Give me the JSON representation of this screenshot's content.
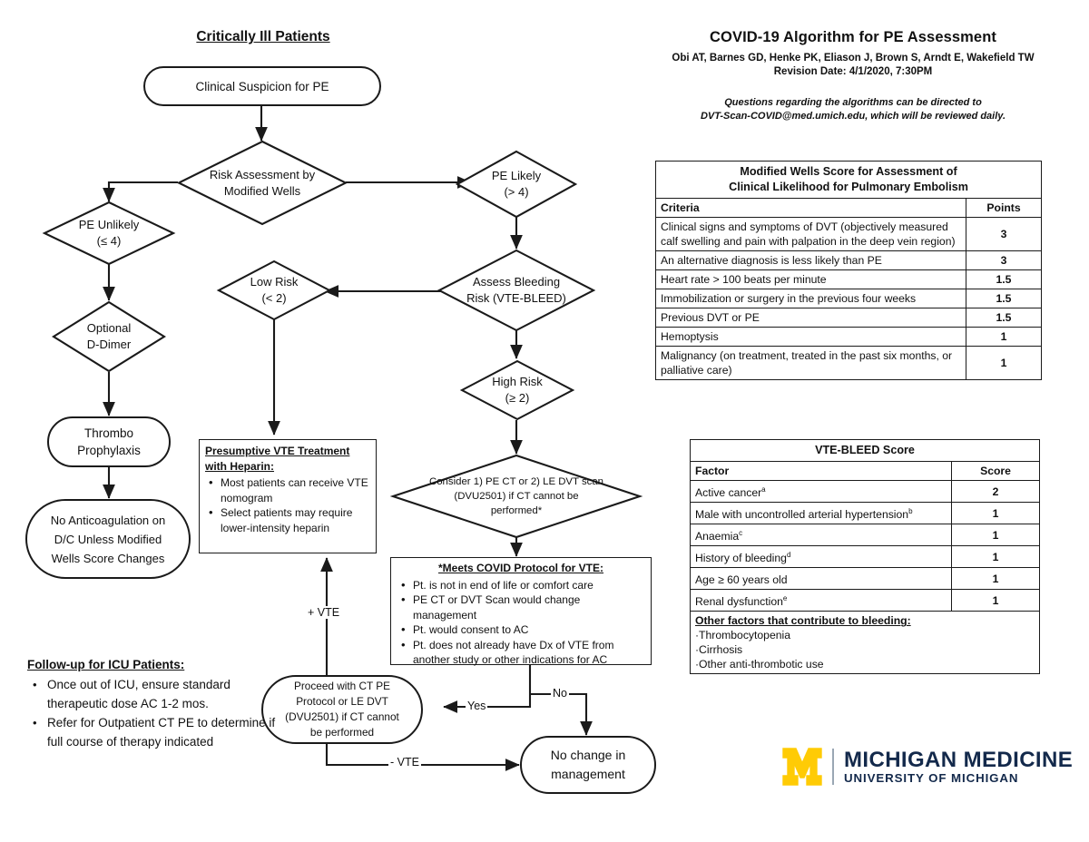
{
  "header": {
    "title": "COVID-19 Algorithm for PE Assessment",
    "authors": "Obi AT, Barnes GD, Henke PK, Eliason J, Brown S, Arndt E, Wakefield TW",
    "revision": "Revision Date: 4/1/2020, 7:30PM",
    "questions_line1": "Questions regarding the algorithms can be directed to",
    "questions_line2": "DVT-Scan-COVID@med.umich.edu, which will be reviewed daily."
  },
  "flow": {
    "section_title": "Critically Ill Patients",
    "start": "Clinical Suspicion for PE",
    "risk_assessment_l1": "Risk Assessment by",
    "risk_assessment_l2": "Modified Wells",
    "pe_unlikely_l1": "PE Unlikely",
    "pe_unlikely_l2": "(≤ 4)",
    "pe_likely_l1": "PE Likely",
    "pe_likely_l2": "(> 4)",
    "optional_ddimer_l1": "Optional",
    "optional_ddimer_l2": "D-Dimer",
    "thrombo_l1": "Thrombo",
    "thrombo_l2": "Prophylaxis",
    "no_ac_l1": "No Anticoagulation on",
    "no_ac_l2": "D/C Unless Modified",
    "no_ac_l3": "Wells Score Changes",
    "assess_bleeding_l1": "Assess Bleeding",
    "assess_bleeding_l2": "Risk (VTE-BLEED)",
    "low_risk_l1": "Low Risk",
    "low_risk_l2": "(< 2)",
    "high_risk_l1": "High Risk",
    "high_risk_l2": "(≥ 2)",
    "consider_l1": "Consider 1) PE CT or 2) LE DVT scan",
    "consider_l2": "(DVU2501) if CT cannot be",
    "consider_l3": "performed*",
    "proceed_l1": "Proceed with CT PE",
    "proceed_l2": "Protocol or LE DVT",
    "proceed_l3": "(DVU2501) if CT cannot",
    "proceed_l4": "be performed",
    "no_change_l1": "No change in",
    "no_change_l2": "management",
    "edge_yes": "Yes",
    "edge_no": "No",
    "edge_pos_vte": "+ VTE",
    "edge_neg_vte": "- VTE"
  },
  "presumptive_box": {
    "title_l1": "Presumptive VTE Treatment",
    "title_l2": "with Heparin:",
    "bullets": [
      "Most patients can receive VTE nomogram",
      "Select patients may require lower-intensity heparin"
    ]
  },
  "covid_protocol_box": {
    "title": "*Meets COVID Protocol for VTE:",
    "bullets": [
      "Pt. is not in end of life or comfort care",
      "PE CT or DVT Scan would change management",
      "Pt. would consent to AC",
      "Pt. does not already have Dx of VTE from another study or other indications for AC"
    ]
  },
  "followup": {
    "title": "Follow-up for ICU Patients:",
    "bullets": [
      "Once out of ICU, ensure standard therapeutic dose AC 1-2 mos.",
      "Refer for Outpatient CT PE to determine if full course of therapy indicated"
    ]
  },
  "wells_table": {
    "title_l1": "Modified Wells Score for Assessment of",
    "title_l2": "Clinical Likelihood for Pulmonary Embolism",
    "col_criteria": "Criteria",
    "col_points": "Points",
    "rows": [
      {
        "criteria": "Clinical signs and symptoms of DVT (objectively measured calf swelling and pain with palpation in the deep vein region)",
        "points": "3"
      },
      {
        "criteria": "An alternative diagnosis is less likely than PE",
        "points": "3"
      },
      {
        "criteria": "Heart rate > 100 beats per minute",
        "points": "1.5"
      },
      {
        "criteria": "Immobilization or surgery in the previous four weeks",
        "points": "1.5"
      },
      {
        "criteria": "Previous DVT or PE",
        "points": "1.5"
      },
      {
        "criteria": "Hemoptysis",
        "points": "1"
      },
      {
        "criteria": "Malignancy (on treatment, treated in the past six months, or palliative care)",
        "points": "1"
      }
    ]
  },
  "vtebleed_table": {
    "title": "VTE-BLEED Score",
    "col_factor": "Factor",
    "col_score": "Score",
    "rows": [
      {
        "factor": "Active cancer",
        "sup": "a",
        "score": "2"
      },
      {
        "factor": "Male with uncontrolled arterial hypertension",
        "sup": "b",
        "score": "1"
      },
      {
        "factor": "Anaemia",
        "sup": "c",
        "score": "1"
      },
      {
        "factor": "History of bleeding",
        "sup": "d",
        "score": "1"
      },
      {
        "factor": "Age ≥ 60 years old",
        "sup": "",
        "score": "1"
      },
      {
        "factor": "Renal dysfunction",
        "sup": "e",
        "score": "1"
      }
    ],
    "other_title": "Other factors that contribute to bleeding:",
    "other_items": [
      "·Thrombocytopenia",
      "·Cirrhosis",
      "·Other anti-thrombotic use"
    ]
  },
  "logo": {
    "letter": "M",
    "line1": "MICHIGAN MEDICINE",
    "line2": "UNIVERSITY OF MICHIGAN",
    "yellow": "#FFCB05",
    "navy": "#13294B"
  }
}
